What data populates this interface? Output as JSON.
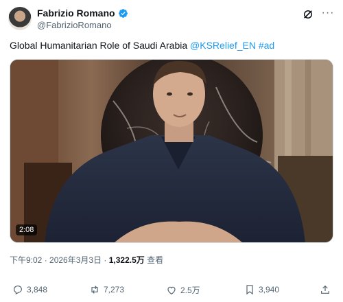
{
  "author": {
    "display_name": "Fabrizio Romano",
    "handle": "@FabrizioRomano",
    "verified_icon": "verified-badge-icon"
  },
  "tweet": {
    "text": "Global Humanitarian Role of Saudi Arabia",
    "mention": "@KSRelief_EN",
    "hashtag": "#ad"
  },
  "video": {
    "duration": "2:08"
  },
  "meta": {
    "time": "下午9:02",
    "separator": " · ",
    "date": "2026年3月3日",
    "views": "1,322.5万",
    "views_label": " 查看"
  },
  "actions": {
    "replies": "3,848",
    "reposts": "7,273",
    "likes": "2.5万",
    "bookmarks": "3,940"
  },
  "colors": {
    "accent": "#1d9bf0",
    "muted": "#536471",
    "repost_green": "#00ba7c"
  }
}
